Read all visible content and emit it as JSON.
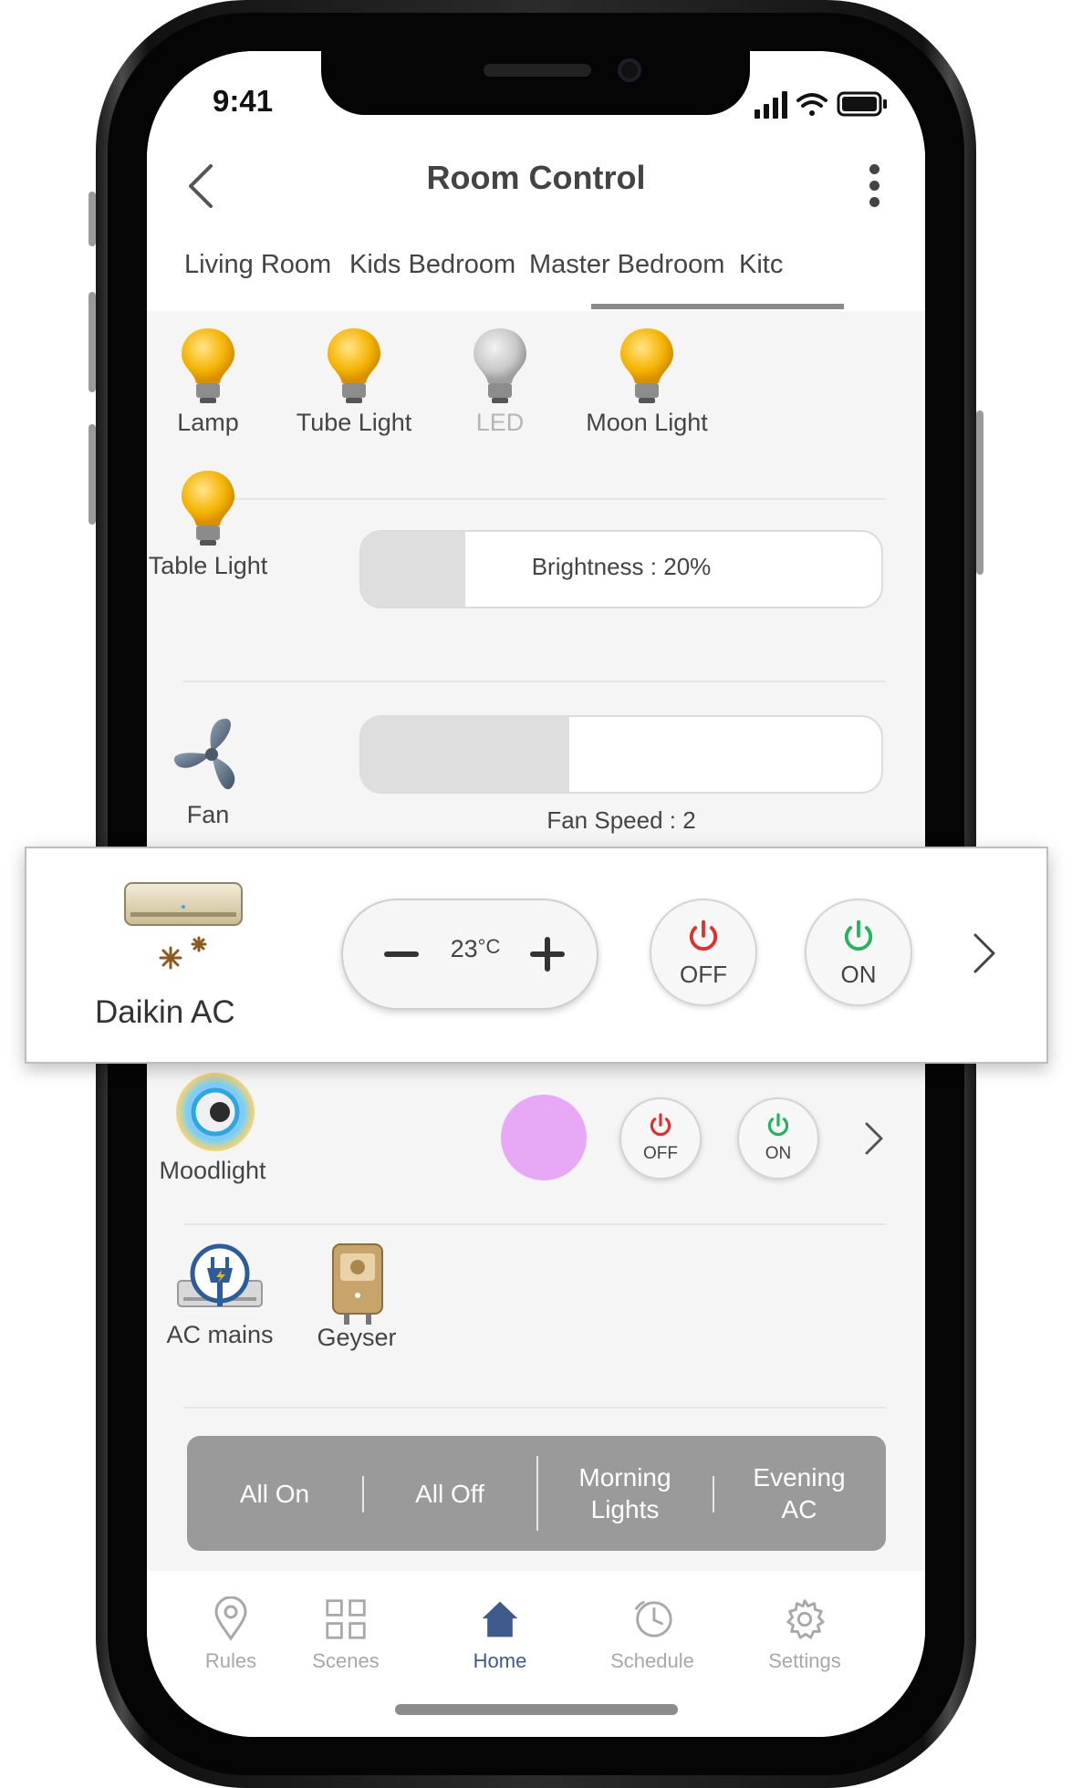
{
  "status": {
    "time": "9:41"
  },
  "header": {
    "title": "Room Control"
  },
  "tabs": [
    {
      "label": "Living Room"
    },
    {
      "label": "Kids Bedroom"
    },
    {
      "label": "Master Bedroom",
      "active": true
    },
    {
      "label": "Kitc"
    }
  ],
  "lights": [
    {
      "label": "Lamp",
      "on": true
    },
    {
      "label": "Tube Light",
      "on": true
    },
    {
      "label": "LED",
      "on": false
    },
    {
      "label": "Moon Light",
      "on": true
    }
  ],
  "table_light": {
    "label": "Table Light",
    "brightness_caption": "Brightness : 20%",
    "brightness": 0.2
  },
  "fan": {
    "label": "Fan",
    "speed_caption": "Fan Speed : 2",
    "speed": 0.4
  },
  "ac": {
    "name": "Daikin AC",
    "temperature": "23",
    "unit": "°C",
    "off_label": "OFF",
    "on_label": "ON"
  },
  "moodlight": {
    "label": "Moodlight",
    "color": "#e7a8f6",
    "off_label": "OFF",
    "on_label": "ON"
  },
  "appliances": [
    {
      "label": "AC mains"
    },
    {
      "label": "Geyser"
    }
  ],
  "scenes": [
    {
      "line1": "All On",
      "line2": ""
    },
    {
      "line1": "All Off",
      "line2": ""
    },
    {
      "line1": "Morning",
      "line2": "Lights"
    },
    {
      "line1": "Evening",
      "line2": "AC"
    }
  ],
  "bottom_nav": [
    {
      "label": "Rules",
      "icon": "location-pin-icon"
    },
    {
      "label": "Scenes",
      "icon": "grid-icon"
    },
    {
      "label": "Home",
      "icon": "home-icon",
      "active": true
    },
    {
      "label": "Schedule",
      "icon": "clock-icon"
    },
    {
      "label": "Settings",
      "icon": "gear-icon"
    }
  ],
  "colors": {
    "bulb_on": "#f4b400",
    "bulb_off": "#c8c8c8",
    "power_off": "#e0302e",
    "power_on": "#23b460",
    "nav_active": "#3e5a8c"
  }
}
